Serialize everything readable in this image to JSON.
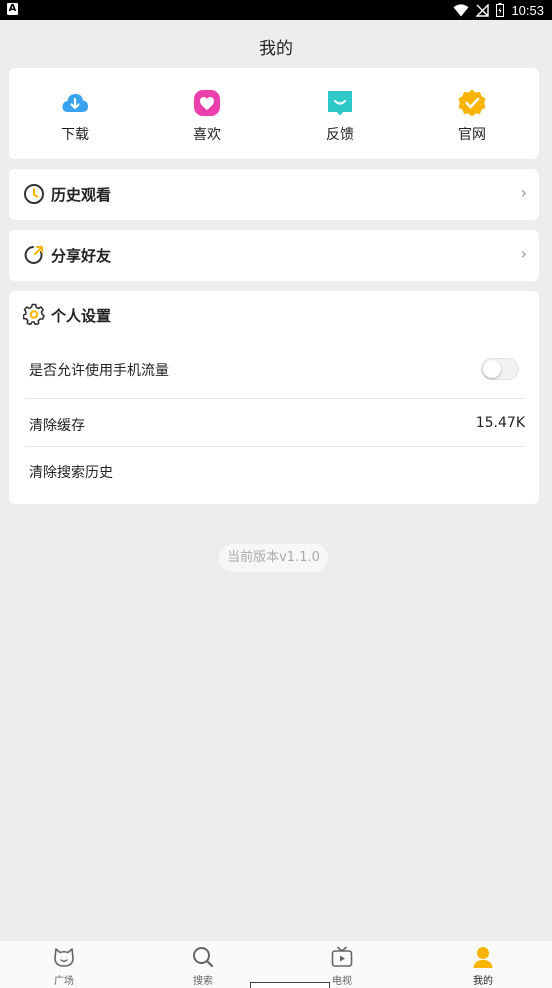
{
  "status_bar": {
    "time": "10:53",
    "left_badge": "A"
  },
  "header": {
    "title": "我的"
  },
  "quick_actions": [
    {
      "label": "下载",
      "icon": "cloud-download-icon",
      "color": "#3aa3f0"
    },
    {
      "label": "喜欢",
      "icon": "heart-icon",
      "color": "#ec3fae"
    },
    {
      "label": "反馈",
      "icon": "feedback-icon",
      "color": "#2ec8c8"
    },
    {
      "label": "官网",
      "icon": "verified-badge-icon",
      "color": "#f8b400"
    }
  ],
  "history": {
    "label": "历史观看",
    "icon": "clock-icon"
  },
  "share": {
    "label": "分享好友",
    "icon": "share-icon"
  },
  "settings": {
    "title": "个人设置",
    "icon": "gear-icon",
    "mobile_data": {
      "label": "是否允许使用手机流量",
      "enabled": false
    },
    "clear_cache": {
      "label": "清除缓存",
      "value": "15.47K"
    },
    "clear_search": {
      "label": "清除搜索历史"
    }
  },
  "version": "当前版本v1.1.0",
  "tabs": [
    {
      "label": "广场",
      "icon": "cat-face-icon",
      "active": false
    },
    {
      "label": "搜索",
      "icon": "search-icon",
      "active": false
    },
    {
      "label": "电视",
      "icon": "tv-icon",
      "active": false
    },
    {
      "label": "我的",
      "icon": "user-icon",
      "active": true
    }
  ],
  "colors": {
    "background": "#eceeed",
    "accent": "#f8b400"
  }
}
